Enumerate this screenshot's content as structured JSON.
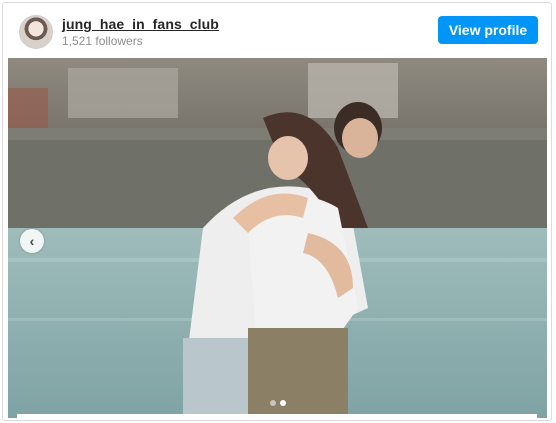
{
  "header": {
    "username": "jung_hae_in_fans_club",
    "followers": "1,521 followers",
    "view_profile_label": "View profile"
  },
  "media": {
    "description_icon": "photo",
    "carousel": {
      "prev_icon": "chevron-left-icon",
      "prev_glyph": "‹",
      "slide_count": 2,
      "active_index": 1
    }
  },
  "colors": {
    "button_bg": "#0095f6",
    "username": "#262626",
    "followers": "#8e8e8e"
  }
}
